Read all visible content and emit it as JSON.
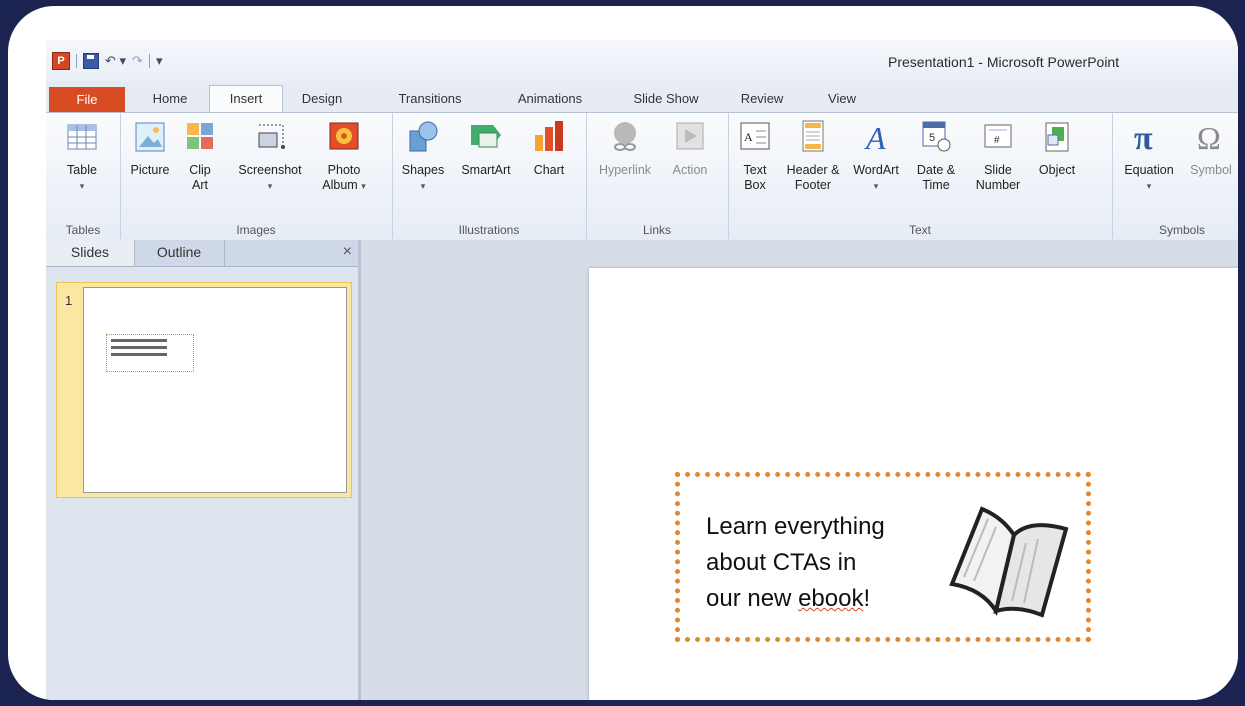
{
  "window": {
    "title": "Presentation1 - Microsoft PowerPoint"
  },
  "quick_access": {
    "app_icon": "P"
  },
  "tabs": [
    {
      "label": "File"
    },
    {
      "label": "Home"
    },
    {
      "label": "Insert"
    },
    {
      "label": "Design"
    },
    {
      "label": "Transitions"
    },
    {
      "label": "Animations"
    },
    {
      "label": "Slide Show"
    },
    {
      "label": "Review"
    },
    {
      "label": "View"
    }
  ],
  "active_tab": "Insert",
  "ribbon": {
    "groups": {
      "tables": "Tables",
      "images": "Images",
      "illustrations": "Illustrations",
      "links": "Links",
      "text": "Text",
      "symbols": "Symbols"
    },
    "buttons": {
      "table": "Table",
      "picture": "Picture",
      "clip_art": "Clip Art",
      "screenshot": "Screenshot",
      "photo_album": "Photo Album",
      "shapes": "Shapes",
      "smartart": "SmartArt",
      "chart": "Chart",
      "hyperlink": "Hyperlink",
      "action": "Action",
      "text_box": "Text Box",
      "header_footer": "Header & Footer",
      "wordart": "WordArt",
      "date_time": "Date & Time",
      "slide_number": "Slide Number",
      "object": "Object",
      "equation": "Equation",
      "symbol": "Symbol"
    }
  },
  "pane": {
    "tab_slides": "Slides",
    "tab_outline": "Outline",
    "close": "×",
    "slide_number": "1"
  },
  "slide": {
    "cta_lines": [
      "Learn everything",
      "about CTAs in",
      "our new "
    ],
    "cta_underlined": "ebook",
    "cta_end": "!"
  },
  "colors": {
    "file_tab": "#d84c24",
    "cta_border": "#e4862d",
    "frame": "#1b2350"
  }
}
